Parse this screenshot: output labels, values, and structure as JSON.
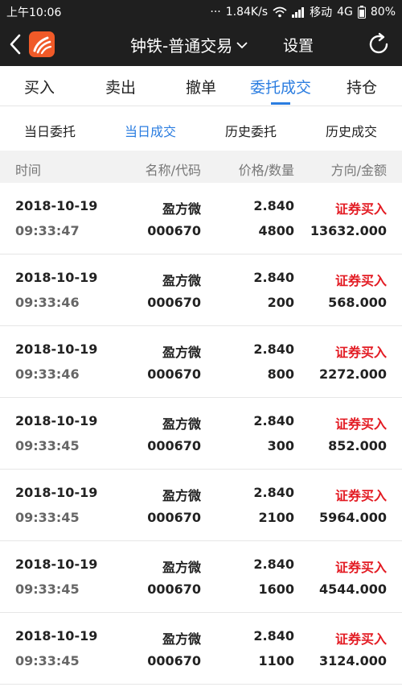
{
  "status_bar": {
    "time": "上午10:06",
    "dots": "···",
    "speed": "1.84K/s",
    "carrier": "移动",
    "network": "4G",
    "battery": "80%"
  },
  "header": {
    "title": "钟铁-普通交易",
    "settings_label": "设置"
  },
  "main_tabs": [
    {
      "label": "买入"
    },
    {
      "label": "卖出"
    },
    {
      "label": "撤单"
    },
    {
      "label": "委托成交"
    },
    {
      "label": "持仓"
    }
  ],
  "active_main_tab": "委托成交",
  "sub_tabs": [
    {
      "label": "当日委托"
    },
    {
      "label": "当日成交"
    },
    {
      "label": "历史委托"
    },
    {
      "label": "历史成交"
    }
  ],
  "active_sub_tab": "当日成交",
  "columns": {
    "time": "时间",
    "name_code": "名称/代码",
    "price_qty": "价格/数量",
    "dir_amount": "方向/金额"
  },
  "trades": [
    {
      "date": "2018-10-19",
      "time": "09:33:47",
      "name": "盈方微",
      "code": "000670",
      "price": "2.840",
      "qty": "4800",
      "direction": "证券买入",
      "amount": "13632.000"
    },
    {
      "date": "2018-10-19",
      "time": "09:33:46",
      "name": "盈方微",
      "code": "000670",
      "price": "2.840",
      "qty": "200",
      "direction": "证券买入",
      "amount": "568.000"
    },
    {
      "date": "2018-10-19",
      "time": "09:33:46",
      "name": "盈方微",
      "code": "000670",
      "price": "2.840",
      "qty": "800",
      "direction": "证券买入",
      "amount": "2272.000"
    },
    {
      "date": "2018-10-19",
      "time": "09:33:45",
      "name": "盈方微",
      "code": "000670",
      "price": "2.840",
      "qty": "300",
      "direction": "证券买入",
      "amount": "852.000"
    },
    {
      "date": "2018-10-19",
      "time": "09:33:45",
      "name": "盈方微",
      "code": "000670",
      "price": "2.840",
      "qty": "2100",
      "direction": "证券买入",
      "amount": "5964.000"
    },
    {
      "date": "2018-10-19",
      "time": "09:33:45",
      "name": "盈方微",
      "code": "000670",
      "price": "2.840",
      "qty": "1600",
      "direction": "证券买入",
      "amount": "4544.000"
    },
    {
      "date": "2018-10-19",
      "time": "09:33:45",
      "name": "盈方微",
      "code": "000670",
      "price": "2.840",
      "qty": "1100",
      "direction": "证券买入",
      "amount": "3124.000"
    }
  ],
  "colors": {
    "accent": "#2b7de0",
    "buy_direction": "#e31b23",
    "header_bg": "#1f1f1f",
    "logo": "#f05a28"
  }
}
